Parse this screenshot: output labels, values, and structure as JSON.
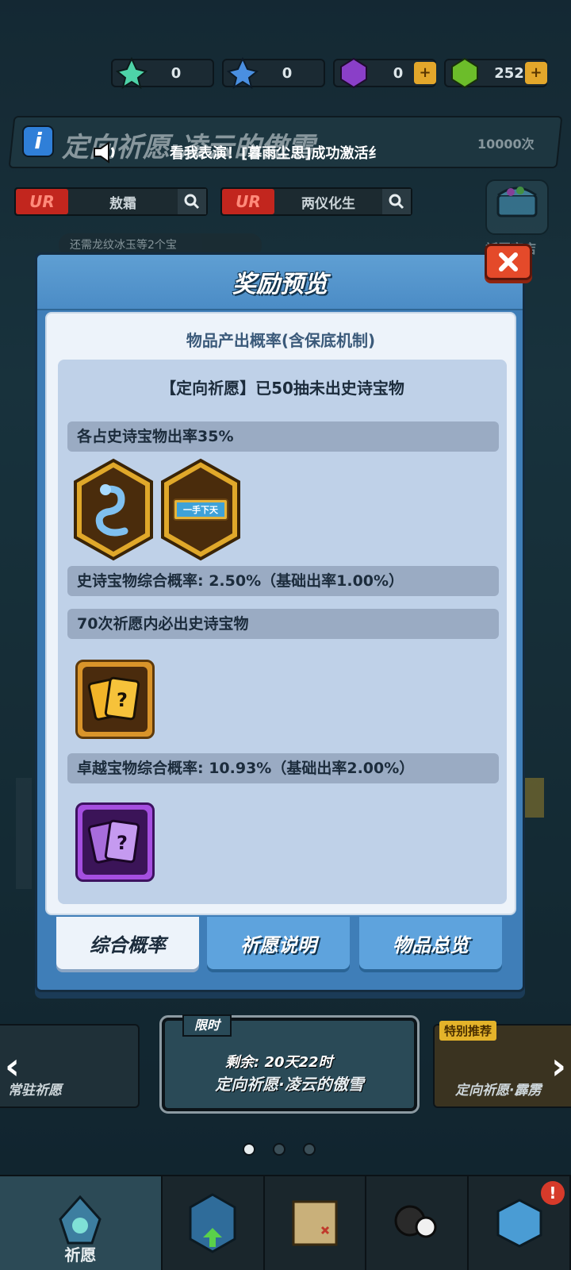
{
  "currency": [
    {
      "icon": "green-star-icon",
      "value": "0"
    },
    {
      "icon": "blue-star-icon",
      "value": "0"
    },
    {
      "icon": "purple-gem-icon",
      "value": "0",
      "plus": "+"
    },
    {
      "icon": "green-gem-icon",
      "value": "252",
      "plus": "+"
    }
  ],
  "header": {
    "title": "定向祈愿·凌云的傲雪",
    "marquee": "看我表演！[暮雨尘思]成功激活纟",
    "count": "10000次"
  },
  "search": [
    {
      "rarity": "UR",
      "name": "敖霜"
    },
    {
      "rarity": "UR",
      "name": "两仪化生"
    }
  ],
  "hint": "还需龙纹冰玉等2个宝",
  "shop_label": "祈愿商店",
  "modal": {
    "title": "奖励预览",
    "close_label": "X",
    "panel_heading": "物品产出概率(含保底机制)",
    "banner": "【定向祈愿】已50抽未出史诗宝物",
    "sections": [
      "各占史诗宝物出率35%",
      "史诗宝物综合概率: 2.50%（基础出率1.00%）",
      "70次祈愿内必出史诗宝物",
      "卓越宝物综合概率: 10.93%（基础出率2.00%）"
    ],
    "plaque_text": "一手下天",
    "card_mark": "?",
    "tabs": [
      "综合概率",
      "祈愿说明",
      "物品总览"
    ]
  },
  "banners": {
    "left_label": "常驻祈愿",
    "limited_tag": "限时",
    "remaining": "剩余: 20天22时",
    "center_name": "定向祈愿·凌云的傲雪",
    "special_tag": "特别推荐",
    "right_label": "定向祈愿·霹雳"
  },
  "nav": {
    "active_label": "祈愿",
    "badge": "!"
  },
  "colors": {
    "modal_bg": "#3f7eb8",
    "close_button": "#e44a2a",
    "epic_gold": "#d9942a",
    "excellent_purple": "#a54fe0"
  }
}
